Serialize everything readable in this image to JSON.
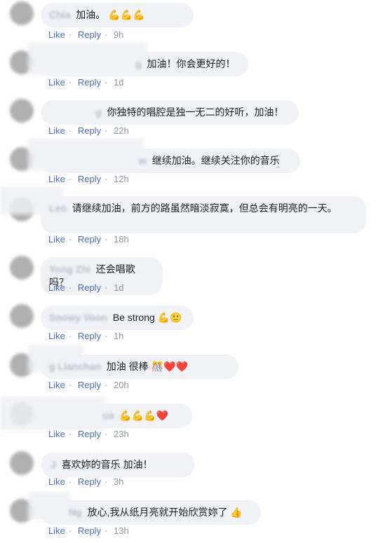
{
  "ui": {
    "like": "Like",
    "reply": "Reply",
    "dot": "·"
  },
  "comments": [
    {
      "name": "Chia",
      "text": "加油。",
      "emoji": "💪💪💪",
      "time": "9h"
    },
    {
      "name": "g",
      "text": "加油！你会更好的！",
      "emoji": "",
      "time": "1d"
    },
    {
      "name": "g",
      "text": "你独特的唱腔是独一无二的好听，加油！",
      "emoji": "",
      "time": "22h"
    },
    {
      "name": "w",
      "text": "继续加油。继续关注你的音乐",
      "emoji": "",
      "time": "12h"
    },
    {
      "name": "Leo",
      "text": "请继续加油，前方的路虽然暗淡寂寞，但总会有明亮的一天。",
      "emoji": "",
      "time": "18h"
    },
    {
      "name": "Yong Zhi",
      "text": "还会唱歌吗？",
      "emoji": "",
      "time": "1d"
    },
    {
      "name": "Snowy Voon",
      "text": "Be strong",
      "emoji": "💪🙂",
      "time": "1h"
    },
    {
      "name": "g Lianchan",
      "text": "加油 很棒",
      "emoji": "🎊❤️❤️",
      "time": "20h"
    },
    {
      "name": "ua",
      "text": "",
      "emoji": "💪💪💪❤️",
      "time": "23h"
    },
    {
      "name": "J",
      "text": "喜欢妳的音乐 加油！",
      "emoji": "",
      "time": "3h"
    },
    {
      "name": "Ng",
      "text": "放心,我从纸月亮就开始欣赏妳了",
      "emoji": "👍",
      "time": "13h"
    }
  ]
}
